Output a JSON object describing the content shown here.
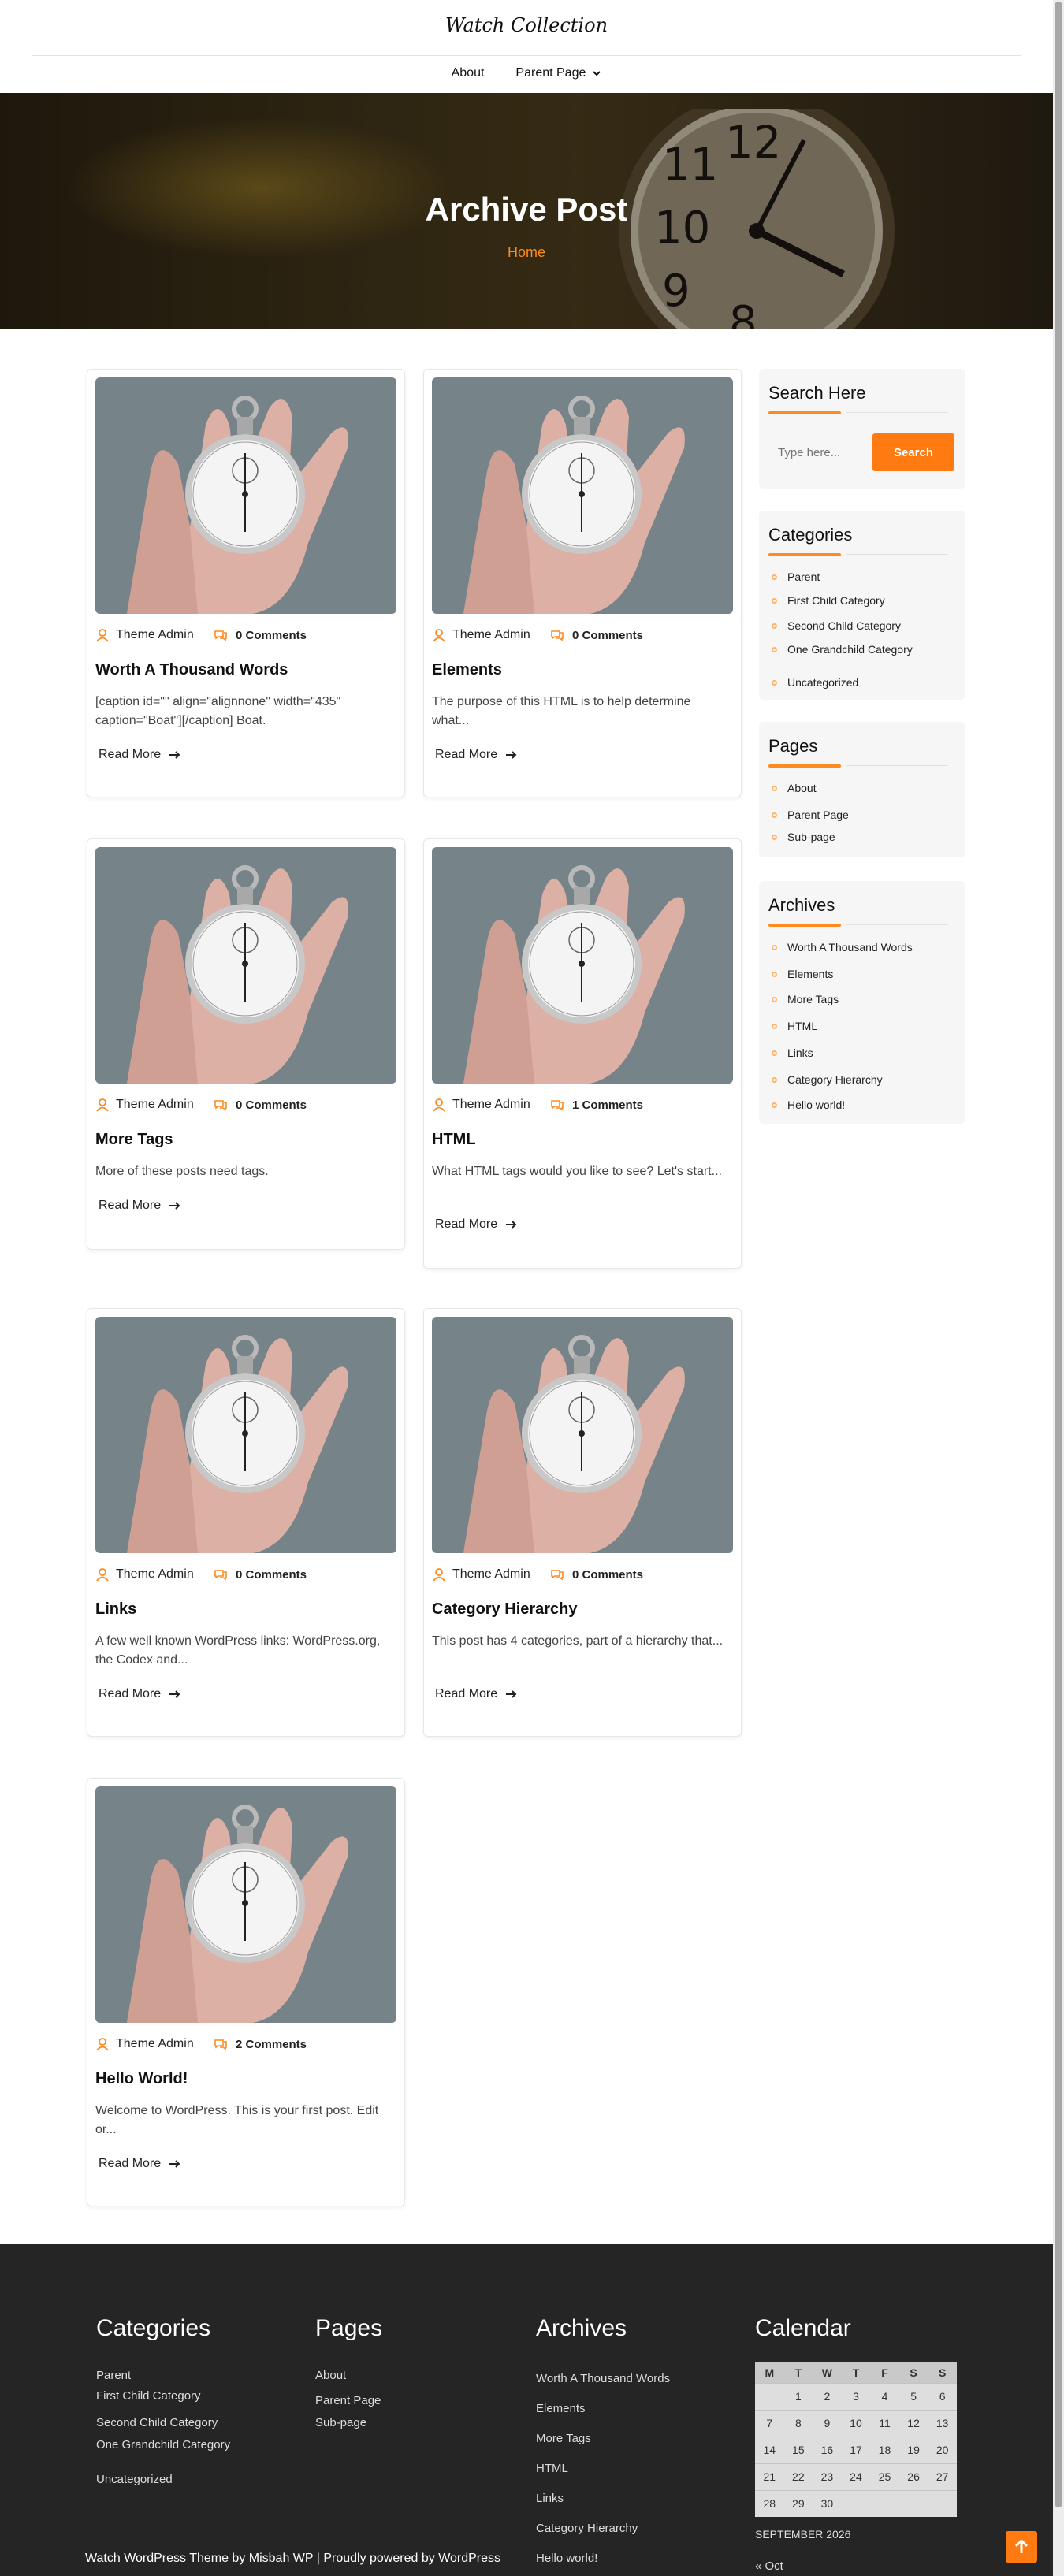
{
  "site": {
    "title": "Watch Collection"
  },
  "nav": {
    "items": [
      "About",
      "Parent Page"
    ]
  },
  "hero": {
    "title": "Archive Post",
    "breadcrumb": "Home"
  },
  "posts": [
    {
      "author": "Theme Admin",
      "comments": "0 Comments",
      "title": "Worth A Thousand Words",
      "excerpt": "[caption id=\"\" align=\"alignnone\" width=\"435\" caption=\"Boat\"][/caption] Boat.",
      "read_more": "Read More"
    },
    {
      "author": "Theme Admin",
      "comments": "0 Comments",
      "title": "Elements",
      "excerpt": "The purpose of this HTML is to help determine what...",
      "read_more": "Read More"
    },
    {
      "author": "Theme Admin",
      "comments": "0 Comments",
      "title": "More Tags",
      "excerpt": "More of these posts need tags.",
      "read_more": "Read More"
    },
    {
      "author": "Theme Admin",
      "comments": "1 Comments",
      "title": "HTML",
      "excerpt": "What HTML tags would you like to see? Let's start...",
      "read_more": "Read More"
    },
    {
      "author": "Theme Admin",
      "comments": "0 Comments",
      "title": "Links",
      "excerpt": "A few well known WordPress links: WordPress.org, the Codex and...",
      "read_more": "Read More"
    },
    {
      "author": "Theme Admin",
      "comments": "0 Comments",
      "title": "Category Hierarchy",
      "excerpt": "This post has 4 categories, part of a hierarchy that...",
      "read_more": "Read More"
    },
    {
      "author": "Theme Admin",
      "comments": "2 Comments",
      "title": "Hello World!",
      "excerpt": "Welcome to WordPress. This is your first post. Edit or...",
      "read_more": "Read More"
    }
  ],
  "sidebar": {
    "search": {
      "title": "Search Here",
      "placeholder": "Type here...",
      "button": "Search"
    },
    "categories": {
      "title": "Categories",
      "items": [
        "Parent",
        "First Child Category",
        "Second Child Category",
        "One Grandchild Category",
        "Uncategorized"
      ]
    },
    "pages": {
      "title": "Pages",
      "items": [
        "About",
        "Parent Page",
        "Sub-page"
      ]
    },
    "archives": {
      "title": "Archives",
      "items": [
        "Worth A Thousand Words",
        "Elements",
        "More Tags",
        "HTML",
        "Links",
        "Category Hierarchy",
        "Hello world!"
      ]
    }
  },
  "footer": {
    "categories": {
      "title": "Categories",
      "items": [
        "Parent",
        "First Child Category",
        "Second Child Category",
        "One Grandchild Category",
        "Uncategorized"
      ]
    },
    "pages": {
      "title": "Pages",
      "items": [
        "About",
        "Parent Page",
        "Sub-page"
      ]
    },
    "archives": {
      "title": "Archives",
      "items": [
        "Worth A Thousand Words",
        "Elements",
        "More Tags",
        "HTML",
        "Links",
        "Category Hierarchy",
        "Hello world!"
      ]
    },
    "calendar": {
      "title": "Calendar",
      "weekdays": [
        "M",
        "T",
        "W",
        "T",
        "F",
        "S",
        "S"
      ],
      "weeks": [
        [
          "",
          "1",
          "2",
          "3",
          "4",
          "5",
          "6"
        ],
        [
          "7",
          "8",
          "9",
          "10",
          "11",
          "12",
          "13"
        ],
        [
          "14",
          "15",
          "16",
          "17",
          "18",
          "19",
          "20"
        ],
        [
          "21",
          "22",
          "23",
          "24",
          "25",
          "26",
          "27"
        ],
        [
          "28",
          "29",
          "30",
          "",
          "",
          "",
          ""
        ]
      ],
      "caption": "SEPTEMBER 2026",
      "prev": "« Oct"
    },
    "copyright": "Watch WordPress Theme by Misbah WP | Proudly powered by WordPress"
  },
  "colors": {
    "accent": "#ff7b12",
    "footer_bg": "#252525"
  },
  "icons": {
    "author": "user-icon",
    "comments": "comments-icon",
    "read_more": "arrow-right-icon",
    "back_to_top": "arrow-up-icon",
    "nav_dropdown": "chevron-down-icon"
  }
}
